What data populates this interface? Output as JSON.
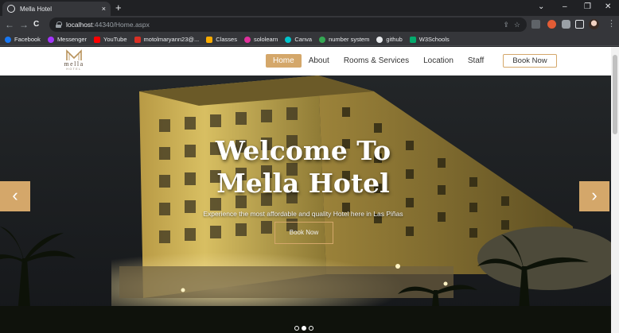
{
  "browser": {
    "tab_title": "Mella Hotel",
    "tab_close": "×",
    "new_tab": "+",
    "url_host": "localhost",
    "url_path": ":44340/Home.aspx",
    "nav_back": "←",
    "nav_forward": "→",
    "nav_reload": "C",
    "win_minimize": "–",
    "win_restore": "❐",
    "win_close": "✕"
  },
  "bookmarks": [
    {
      "label": "Facebook",
      "color": "#1877f2"
    },
    {
      "label": "Messenger",
      "color": "#a334fa"
    },
    {
      "label": "YouTube",
      "color": "#ff0000"
    },
    {
      "label": "motolmaryann23@...",
      "color": "#d93025"
    },
    {
      "label": "Classes",
      "color": "#f9ab00"
    },
    {
      "label": "sololearn",
      "color": "#e0309c"
    },
    {
      "label": "Canva",
      "color": "#00c4cc"
    },
    {
      "label": "number system",
      "color": "#34a853"
    },
    {
      "label": "github",
      "color": "#e8eaed"
    },
    {
      "label": "W3Schools",
      "color": "#04aa6d"
    }
  ],
  "site": {
    "logo_text": "mella",
    "logo_sub": "HOTEL",
    "nav": [
      {
        "label": "Home",
        "active": true
      },
      {
        "label": "About"
      },
      {
        "label": "Rooms & Services"
      },
      {
        "label": "Location"
      },
      {
        "label": "Staff"
      }
    ],
    "book_now": "Book Now",
    "accent_color": "#d4a76a"
  },
  "hero": {
    "title_line1": "Welcome To",
    "title_line2": "Mella Hotel",
    "subtitle": "Experience the most affordable and quality Hotel here in Las Piñas",
    "button": "Book Now",
    "prev_arrow": "‹",
    "next_arrow": "›",
    "slide_count": 3,
    "active_slide": 1
  }
}
